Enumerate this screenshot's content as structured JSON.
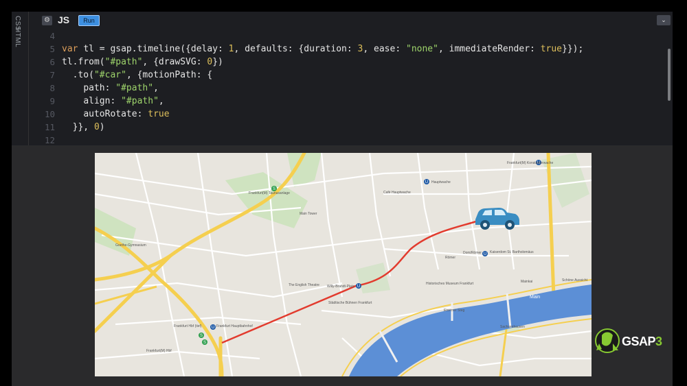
{
  "editor": {
    "side_tabs": [
      "CSS",
      "HTML"
    ],
    "language": "JS",
    "settings_icon": "gear-icon",
    "run_label": "Run",
    "collapse_icon": "chevron-down-icon"
  },
  "code": {
    "line_numbers": [
      "4",
      "5",
      "6",
      "7",
      "8",
      "9",
      "10",
      "11",
      "12"
    ],
    "lines": [
      "",
      "var tl = gsap.timeline({delay: 1, defaults: {duration: 3, ease: \"none\", immediateRender: true}});",
      "tl.from(\"#path\", {drawSVG: 0})",
      "  .to(\"#car\", {motionPath: {",
      "    path: \"#path\",",
      "    align: \"#path\",",
      "    autoRotate: true",
      "  }}, 0)",
      ""
    ]
  },
  "map": {
    "labels": [
      "Frankfurt(M) Taunusanlage",
      "Main Tower",
      "Hauptwache",
      "Frankfurt(M) Konstablerwache",
      "Willy-Brandt-Platz",
      "The English Theatre",
      "Römer",
      "Dom/Römer",
      "Kaiserdom St. Bartholomäus",
      "Frankfurt Hbf (tief)",
      "Frankfurt Hauptbahnhof",
      "Main",
      "Eiserner Steg",
      "Sachsenhausen",
      "Städtische Bühnen Frankfurt",
      "Historisches Museum Frankfurt",
      "Goethe-Gymnasium",
      "Café Hauptwache",
      "Frankfurt(M) Hbf",
      "Mainkai",
      "Schöne Aussicht"
    ],
    "route_color": "#e23b2e",
    "car_color": "#3a8dc2",
    "river_color": "#5c8fd6"
  },
  "branding": {
    "logo_text": "GSAP",
    "logo_version": "3"
  }
}
